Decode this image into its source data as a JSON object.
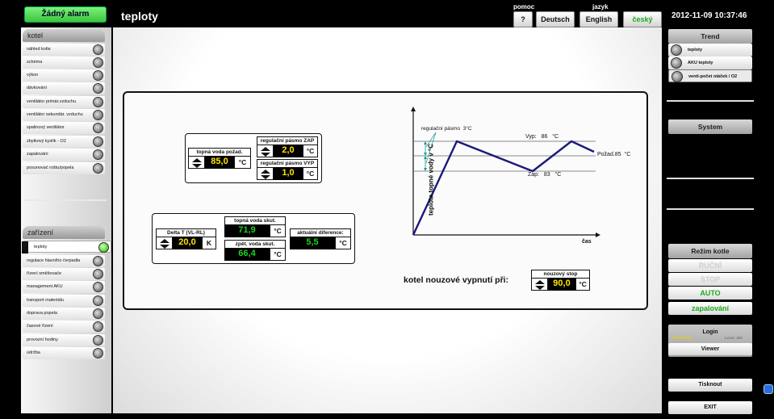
{
  "header": {
    "alarm": "Žádný alarm",
    "title": "teploty",
    "help_label": "pomoc",
    "help_button": "?",
    "language_label": "jazyk",
    "languages": [
      "Deutsch",
      "English",
      "český"
    ],
    "active_language": "český",
    "datetime": "2012-11-09 10:37:46"
  },
  "sidebar": {
    "kotel_title": "kotel",
    "kotel_items": [
      "náhled kotle",
      "schéma",
      "výkon",
      "dávkování",
      "ventilátor primár.vzduchu",
      "ventilátor sekundár. vzduchu",
      "spalinový ventilátor",
      "zbytkový kyslík - O2",
      "zapalování",
      "posunovač roštu/popela"
    ],
    "zarizeni_title": "zařízení",
    "zarizeni_items": [
      "teploty",
      "regulace hlavního čerpadla",
      "řízení směšovače",
      "management AKU",
      "transport materiálu",
      "doprava popela",
      "časové řízení",
      "provozní hodiny",
      "údržba"
    ],
    "selected": "teploty"
  },
  "main": {
    "setpoint": {
      "label": "topná voda požad.",
      "value": "85,0",
      "unit": "°C"
    },
    "band_on": {
      "label": "regulační pásmo ZAP",
      "value": "2,0",
      "unit": "°C"
    },
    "band_off": {
      "label": "regulační pásmo VYP",
      "value": "1,0",
      "unit": "°C"
    },
    "delta_t": {
      "label": "Delta T (VL-RL)",
      "value": "20,0",
      "unit": "K"
    },
    "flow_actual": {
      "label": "topná voda skut.",
      "value": "71,9",
      "unit": "°C"
    },
    "return_actual": {
      "label": "zpět. voda skut.",
      "value": "66,4",
      "unit": "°C"
    },
    "current_diff": {
      "label": "aktuální diference:",
      "value": "5,5",
      "unit": "°C"
    },
    "emergency_title": "kotel nouzové vypnutí při:",
    "emergency_stop": {
      "label": "nouzový stop",
      "value": "90,0",
      "unit": "°C"
    },
    "graph": {
      "ylabel": "teplota topné vody v °C",
      "xlabel": "čas",
      "band_label": "regulační pásmo",
      "band_value": "3°C",
      "vyp_label": "Vyp:",
      "vyp_value": "86",
      "vyp_unit": "°C",
      "zap_label": "Zap:",
      "zap_value": "83",
      "zap_unit": "°C",
      "pozad_label": "Požad.85",
      "pozad_unit": "°C"
    }
  },
  "right": {
    "trend_title": "Trend",
    "trend_items": [
      "teploty",
      "AKU teploty",
      "venti-počet otáček / O2"
    ],
    "system_title": "System",
    "mode_title": "Režim kotle",
    "modes": [
      "RUČNÍ",
      "STOP",
      "AUTO",
      "zapalování"
    ],
    "login": "Login",
    "operator": "OPERATOR",
    "level": "Level: 400",
    "viewer": "Viewer",
    "print": "Tisknout",
    "exit": "EXIT"
  }
}
